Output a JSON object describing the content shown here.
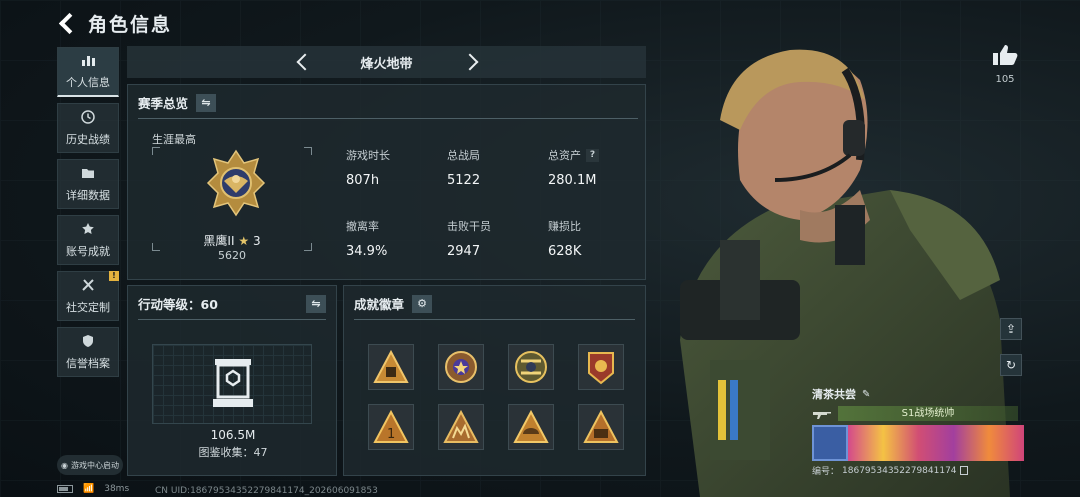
{
  "header": {
    "title": "角色信息"
  },
  "sidebar": {
    "items": [
      {
        "label": "个人信息",
        "icon": "bar-chart-icon",
        "active": true
      },
      {
        "label": "历史战绩",
        "icon": "clock-icon"
      },
      {
        "label": "详细数据",
        "icon": "folder-icon"
      },
      {
        "label": "账号成就",
        "icon": "achievement-icon"
      },
      {
        "label": "社交定制",
        "icon": "tools-icon",
        "badge": "!"
      },
      {
        "label": "信誉档案",
        "icon": "shield-icon"
      }
    ],
    "help_center": "游戏中心启动"
  },
  "mode": {
    "name": "烽火地带"
  },
  "season": {
    "title": "赛季总览",
    "career_label": "生涯最高",
    "rank_name": "黑鹰II",
    "rank_stars": "3",
    "rank_points": "5620",
    "stats": [
      {
        "label": "游戏时长",
        "value": "807h"
      },
      {
        "label": "总战局",
        "value": "5122"
      },
      {
        "label": "总资产",
        "value": "280.1M",
        "help": "?"
      },
      {
        "label": "撤离率",
        "value": "34.9%"
      },
      {
        "label": "击败干员",
        "value": "2947"
      },
      {
        "label": "赚损比",
        "value": "628K"
      }
    ]
  },
  "level": {
    "title_prefix": "行动等级：",
    "level": "60",
    "value": "106.5M",
    "collection_label": "图鉴收集：",
    "collection_count": "47"
  },
  "medals": {
    "title": "成就徽章",
    "items": [
      "medal-1",
      "medal-2",
      "medal-3",
      "medal-4",
      "medal-5",
      "medal-6",
      "medal-7",
      "medal-8"
    ]
  },
  "profile": {
    "likes": "105",
    "name": "清茶共尝",
    "title_tag": "S1战场统帅",
    "id_label": "编号：",
    "id_value": "18679534352279841174"
  },
  "status": {
    "ping": "38ms",
    "uid": "CN UID:18679534352279841174_202606091853"
  },
  "colors": {
    "gold": "#c9a45a",
    "panel": "#1e292e",
    "accent_green": "#56783c"
  }
}
